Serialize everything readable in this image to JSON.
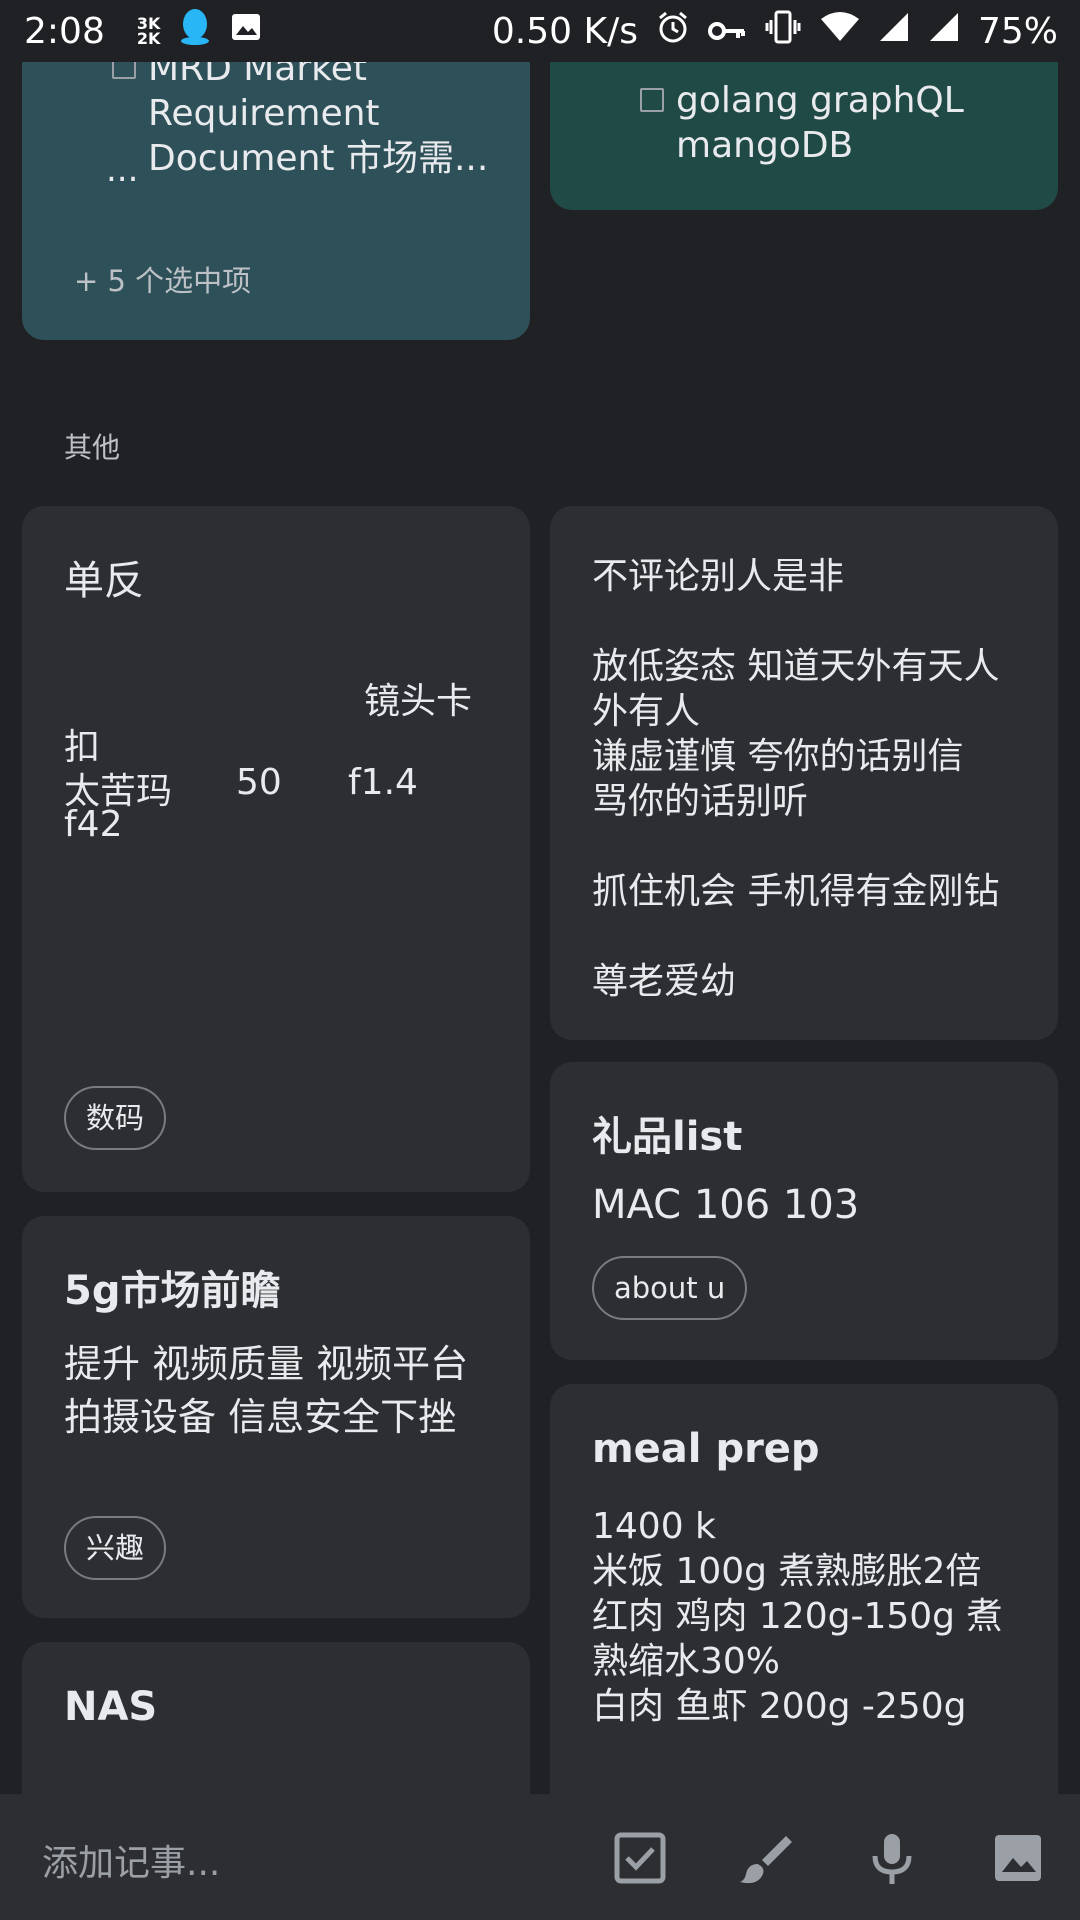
{
  "status_bar": {
    "time": "2:08",
    "speed_badge_top": "3K",
    "speed_badge_bottom": "2K",
    "net_speed": "0.50 K/s",
    "battery": "75%",
    "icons": [
      "qq-icon",
      "image-icon",
      "alarm-icon",
      "key-icon",
      "vibrate-icon",
      "wifi-icon",
      "signal-icon",
      "signal-icon",
      "battery-icon"
    ]
  },
  "pinned": {
    "card1": {
      "item": "MRD Market Requirement Document 市场需...",
      "ellipsis": "...",
      "more": "+ 5 个选中项"
    },
    "card2": {
      "item": "golang graphQL mangoDB"
    }
  },
  "section_label": "其他",
  "notes": {
    "slr": {
      "title": "单反",
      "line1": "镜头卡",
      "line2": "扣",
      "line3a": "太苦玛",
      "line3b": "50",
      "line3c": "f1.4",
      "line4": "f42",
      "label": "数码"
    },
    "principles": {
      "text": "不评论别人是非\n\n放低姿态 知道天外有天人外有人\n谦虚谨慎 夸你的话别信\n骂你的话别听\n\n抓住机会 手机得有金刚钻\n\n尊老爱幼"
    },
    "gift": {
      "title": "礼品list",
      "text": "MAC 106 103",
      "label": "about u"
    },
    "5g": {
      "title": "5g市场前瞻",
      "text": "提升 视频质量 视频平台 拍摄设备 信息安全下挫",
      "label": "兴趣"
    },
    "meal": {
      "title": "meal prep",
      "text": "1400 k\n米饭 100g 煮熟膨胀2倍\n红肉 鸡肉 120g-150g 煮熟缩水30%\n白肉 鱼虾 200g -250g"
    },
    "nas": {
      "title": "NAS"
    }
  },
  "bottom_bar": {
    "placeholder": "添加记事...",
    "icons": [
      "checkbox-icon",
      "brush-icon",
      "mic-icon",
      "image-icon"
    ]
  },
  "colors": {
    "background": "#202124",
    "card": "#2d2e31",
    "teal_card_1": "#2e5059",
    "teal_card_2": "#1f4a46"
  }
}
